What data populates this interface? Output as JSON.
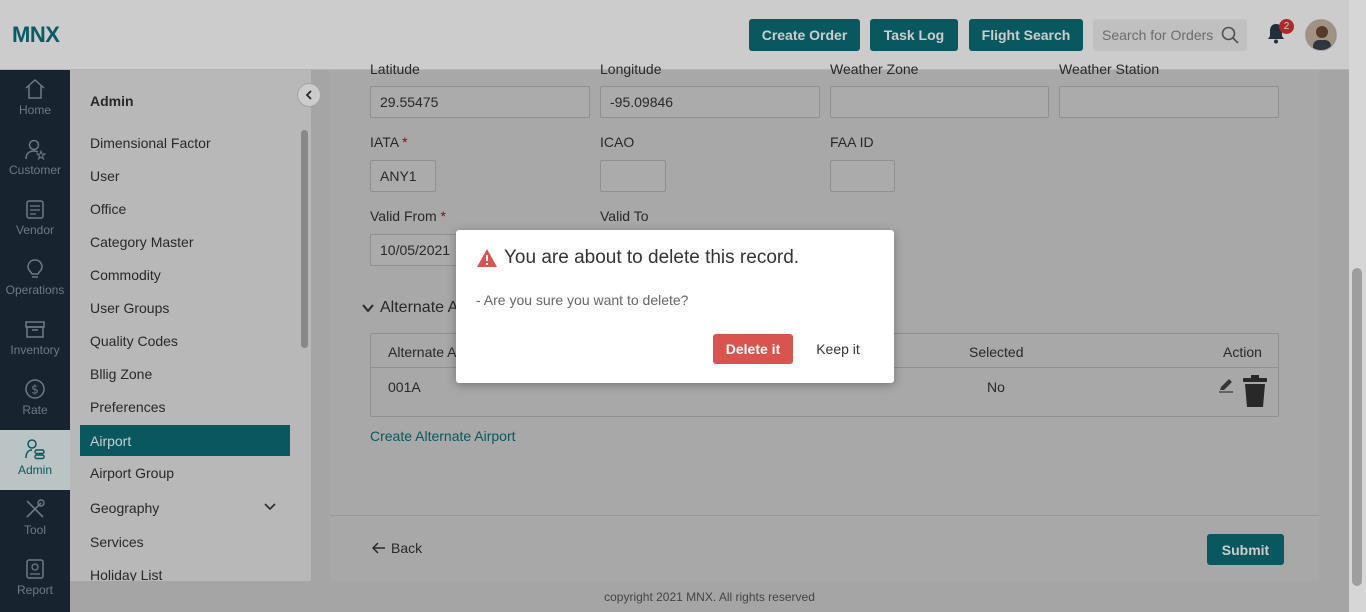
{
  "header": {
    "logo": "MNX",
    "buttons": [
      "Create Order",
      "Task Log",
      "Flight Search"
    ],
    "search_placeholder": "Search for Orders",
    "notification_count": "2"
  },
  "leftnav": [
    {
      "label": "Home",
      "icon": "home-icon"
    },
    {
      "label": "Customer",
      "icon": "customer-icon"
    },
    {
      "label": "Vendor",
      "icon": "vendor-icon"
    },
    {
      "label": "Operations",
      "icon": "operations-icon"
    },
    {
      "label": "Inventory",
      "icon": "inventory-icon"
    },
    {
      "label": "Rate",
      "icon": "rate-icon"
    },
    {
      "label": "Admin",
      "icon": "admin-icon",
      "active": true
    },
    {
      "label": "Tool",
      "icon": "tool-icon"
    },
    {
      "label": "Report",
      "icon": "report-icon"
    }
  ],
  "sidebar": {
    "title": "Admin",
    "items": [
      {
        "label": "Dimensional Factor"
      },
      {
        "label": "User"
      },
      {
        "label": "Office"
      },
      {
        "label": "Category Master"
      },
      {
        "label": "Commodity"
      },
      {
        "label": "User Groups"
      },
      {
        "label": "Quality Codes"
      },
      {
        "label": "Bllig Zone"
      },
      {
        "label": "Preferences"
      },
      {
        "label": "Airport",
        "active": true
      },
      {
        "label": "Airport Group"
      },
      {
        "label": "Geography",
        "expandable": true
      },
      {
        "label": "Services"
      },
      {
        "label": "Holiday List"
      }
    ]
  },
  "form": {
    "latitude_label": "Latitude",
    "latitude_value": "29.55475",
    "longitude_label": "Longitude",
    "longitude_value": "-95.09846",
    "weather_zone_label": "Weather Zone",
    "weather_station_label": "Weather Station",
    "iata_label": "IATA",
    "iata_value": "ANY1",
    "icao_label": "ICAO",
    "faa_label": "FAA ID",
    "valid_from_label": "Valid From",
    "valid_from_value": "10/05/2021",
    "valid_to_label": "Valid To",
    "required_mark": "*"
  },
  "alternate": {
    "section_title": "Alternate Airports",
    "columns": [
      "Alternate Airport",
      "Selected",
      "Action"
    ],
    "rows": [
      {
        "code": "001A",
        "selected": "No"
      }
    ],
    "create_link": "Create Alternate Airport"
  },
  "footer": {
    "back_label": "Back",
    "submit_label": "Submit",
    "copyright": "copyright 2021 MNX. All rights reserved"
  },
  "modal": {
    "title": "You are about to delete this record.",
    "message": "- Are you sure you want to delete?",
    "delete_label": "Delete it",
    "keep_label": "Keep it"
  },
  "colors": {
    "brand": "#0c6f78",
    "danger": "#d9534f",
    "nav_bg": "#1d2c3a"
  }
}
